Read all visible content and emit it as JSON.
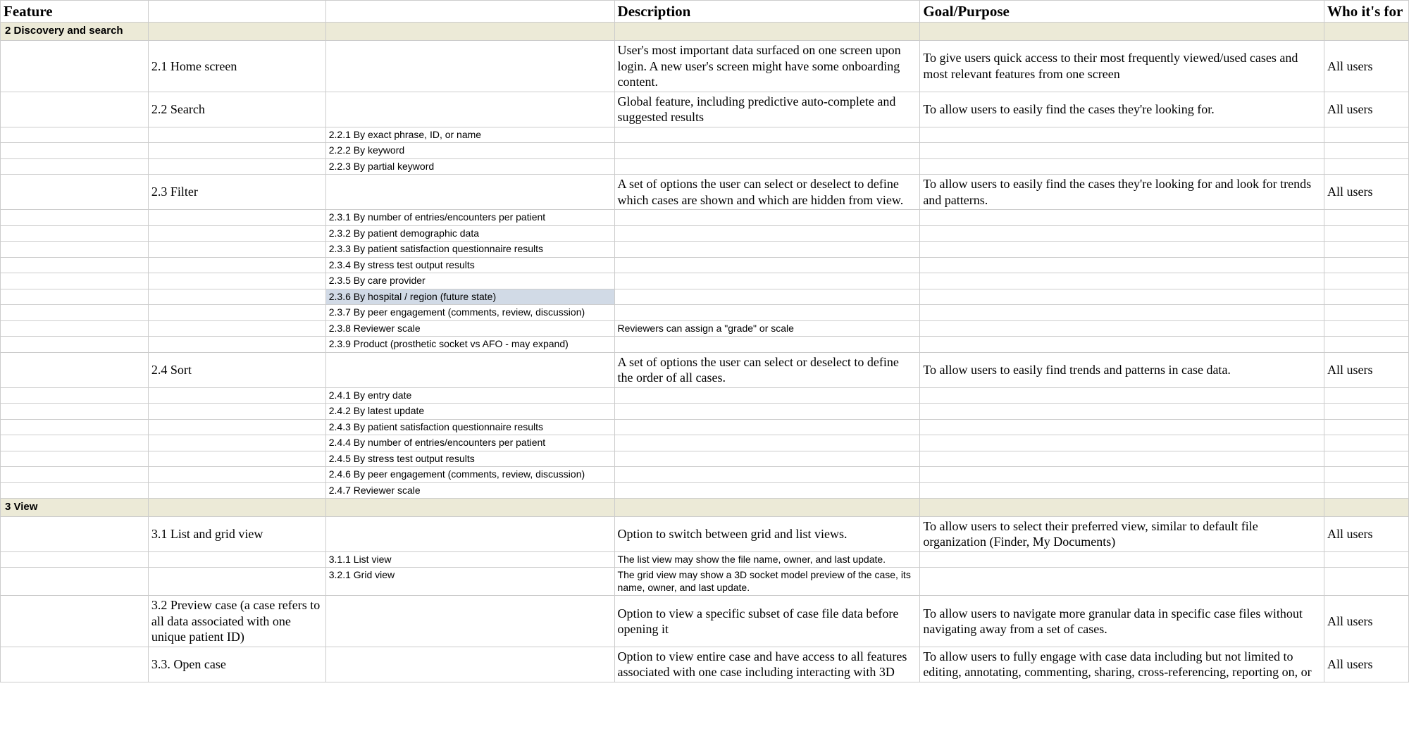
{
  "headers": {
    "feature": "Feature",
    "description": "Description",
    "goal": "Goal/Purpose",
    "who": "Who it's for"
  },
  "rows": [
    {
      "type": "section",
      "c1": "2 Discovery and search"
    },
    {
      "type": "feature",
      "c2": "2.1 Home screen",
      "desc": "User's most important data surfaced on one screen upon login. A new user's screen might have some onboarding content.",
      "goal": "To give users quick access to their most frequently viewed/used cases and most relevant features from one screen",
      "who": "All users"
    },
    {
      "type": "feature",
      "c2": "2.2 Search",
      "desc": "Global feature, including predictive auto-complete and suggested results",
      "goal": "To allow users to easily find the cases they're looking for.",
      "who": "All users"
    },
    {
      "type": "sub",
      "c3": "2.2.1 By exact phrase, ID, or name"
    },
    {
      "type": "sub",
      "c3": "2.2.2 By keyword"
    },
    {
      "type": "sub",
      "c3": "2.2.3 By partial keyword"
    },
    {
      "type": "feature",
      "c2": "2.3 Filter",
      "desc": "A set of options the user can select or deselect to define which cases are shown and which are hidden from view.",
      "goal": "To allow users to easily find the cases they're looking for and look for trends and patterns.",
      "who": "All users"
    },
    {
      "type": "sub",
      "c3": "2.3.1 By number of entries/encounters per patient"
    },
    {
      "type": "sub",
      "c3": "2.3.2 By patient demographic data"
    },
    {
      "type": "sub",
      "c3": "2.3.3 By patient satisfaction questionnaire results"
    },
    {
      "type": "sub",
      "c3": "2.3.4 By stress test output results"
    },
    {
      "type": "sub",
      "c3": "2.3.5 By care provider"
    },
    {
      "type": "sub",
      "c3": "2.3.6 By hospital / region (future state)",
      "highlight": true
    },
    {
      "type": "sub",
      "c3": "2.3.7 By peer engagement (comments, review, discussion)"
    },
    {
      "type": "sub",
      "c3": "2.3.8 Reviewer scale",
      "subdesc": "Reviewers can assign a \"grade\" or scale"
    },
    {
      "type": "sub",
      "c3": "2.3.9 Product (prosthetic socket vs AFO - may expand)"
    },
    {
      "type": "feature",
      "c2": "2.4 Sort",
      "desc": "A set of options the user can select or deselect to define the order of all cases.",
      "goal": "To allow users to easily find trends and patterns in case data.",
      "who": "All users"
    },
    {
      "type": "sub",
      "c3": "2.4.1 By entry date"
    },
    {
      "type": "sub",
      "c3": "2.4.2 By latest update"
    },
    {
      "type": "sub",
      "c3": "2.4.3 By patient satisfaction questionnaire results"
    },
    {
      "type": "sub",
      "c3": "2.4.4 By number of entries/encounters per patient"
    },
    {
      "type": "sub",
      "c3": "2.4.5 By stress test output results"
    },
    {
      "type": "sub",
      "c3": "2.4.6 By peer engagement (comments, review, discussion)"
    },
    {
      "type": "sub",
      "c3": "2.4.7 Reviewer scale"
    },
    {
      "type": "section",
      "c1": "3 View"
    },
    {
      "type": "feature",
      "c2": "3.1 List and grid view",
      "desc": "Option to switch between grid and list views.",
      "goal": "To allow users to select their preferred view, similar to default file organization (Finder, My Documents)",
      "who": "All users"
    },
    {
      "type": "sub",
      "c3": "3.1.1 List view",
      "subdesc": "The list view may show the file name, owner, and last update."
    },
    {
      "type": "sub",
      "c3": "3.2.1 Grid view",
      "subdesc": "The grid view may show a 3D socket model preview of the case, its name, owner, and last update."
    },
    {
      "type": "feature",
      "c2": "3.2 Preview case (a case refers to all data associated with one unique patient ID)",
      "desc": "Option to view a specific subset of case file data before opening it",
      "goal": "To allow users to navigate more granular data in specific case files without navigating away from a set of cases.",
      "who": "All users"
    },
    {
      "type": "feature",
      "c2": "3.3. Open case",
      "desc": "Option to view entire case and have access to all features associated with one case including interacting with 3D",
      "goal": "To allow users to fully engage with case data including but not limited to editing, annotating, commenting, sharing, cross-referencing, reporting on, or",
      "who": "All users"
    }
  ]
}
